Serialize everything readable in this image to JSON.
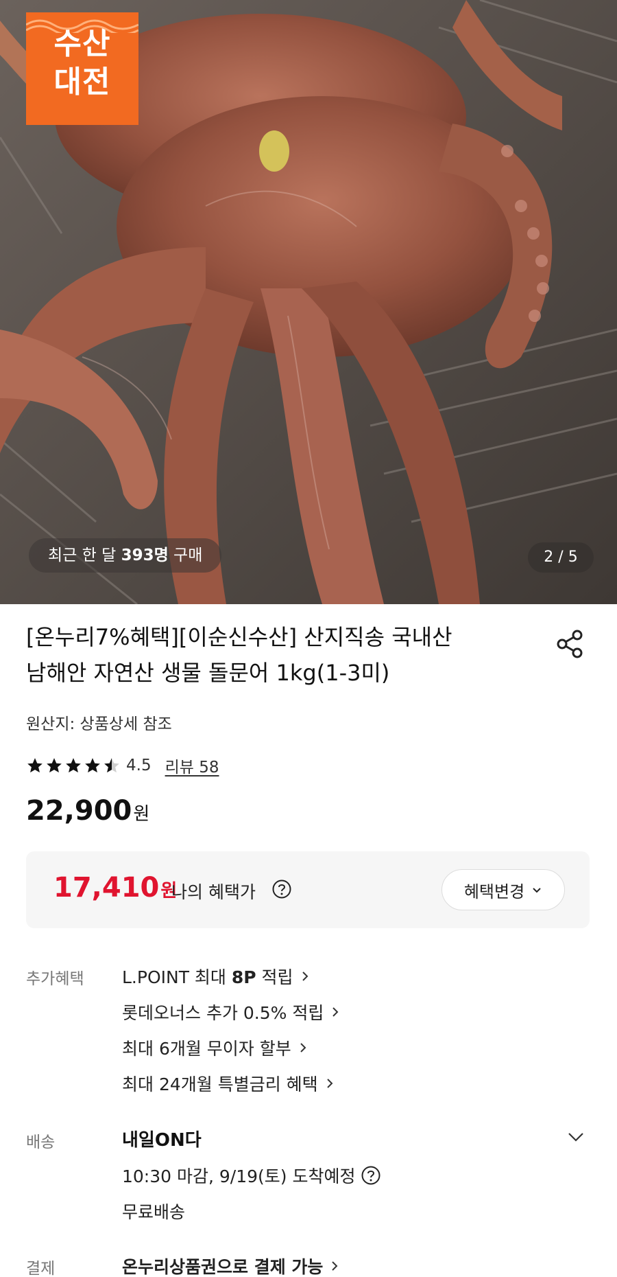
{
  "hero": {
    "badge_line1": "수산",
    "badge_line2": "대전",
    "recent_prefix": "최근 한 달 ",
    "recent_count": "393명",
    "recent_suffix": " 구매",
    "pager": "2 / 5"
  },
  "product": {
    "title_line1": "[온누리7%혜택][이순신수산] 산지직송 국내산",
    "title_line2": "남해안 자연산 생물 돌문어 1kg(1-3미)",
    "origin": "원산지: 상품상세 참조",
    "rating_value": "4.5",
    "rating_fraction": 0.9,
    "review_link": "리뷰 58",
    "price": "22,900",
    "currency": "원"
  },
  "benefit_price": {
    "price": "17,410",
    "currency": "원",
    "label": "나의 혜택가",
    "change_button": "혜택변경"
  },
  "extra_benefits": {
    "label": "추가혜택",
    "items": [
      {
        "text_pre": "L.POINT 최대 ",
        "text_bold": "8P",
        "text_post": " 적립"
      },
      {
        "text_pre": "롯데오너스 추가 0.5% 적립",
        "text_bold": "",
        "text_post": ""
      },
      {
        "text_pre": "최대 6개월 무이자 할부",
        "text_bold": "",
        "text_post": ""
      },
      {
        "text_pre": "최대 24개월 특별금리 혜택",
        "text_bold": "",
        "text_post": ""
      }
    ]
  },
  "shipping": {
    "label": "배송",
    "title": "내일ON다",
    "deadline": "10:30 마감, 9/19(토) 도착예정",
    "fee": "무료배송"
  },
  "payment": {
    "label": "결제",
    "text": "온누리상품권으로 결제 가능"
  },
  "colors": {
    "badge": "#f26a21",
    "sale_red": "#e0142f"
  }
}
